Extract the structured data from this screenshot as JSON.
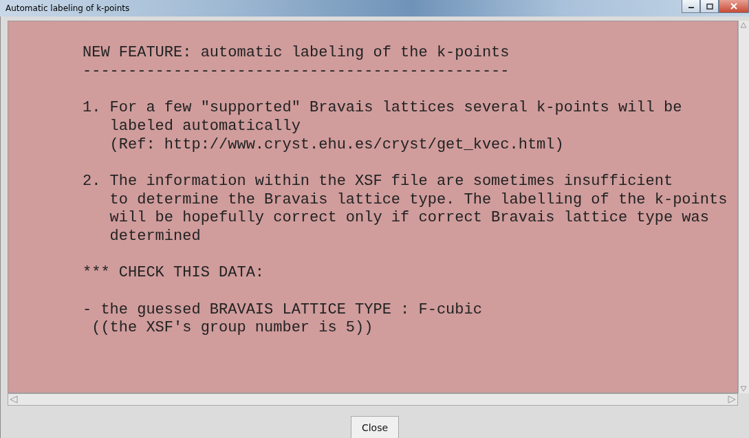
{
  "window": {
    "title": "Automatic labeling of k-points"
  },
  "message": {
    "blocks": [
      [
        "NEW FEATURE: automatic labeling of the k-points",
        "-----------------------------------------------"
      ],
      [
        "1. For a few \"supported\" Bravais lattices several k-points will be",
        "   labeled automatically",
        "   (Ref: http://www.cryst.ehu.es/cryst/get_kvec.html)"
      ],
      [
        "2. The information within the XSF file are sometimes insufficient",
        "   to determine the Bravais lattice type. The labelling of the k-points",
        "   will be hopefully correct only if correct Bravais lattice type was",
        "   determined"
      ],
      [
        "*** CHECK THIS DATA:"
      ],
      [
        "- the guessed BRAVAIS LATTICE TYPE : F-cubic",
        " ((the XSF's group number is 5))"
      ]
    ]
  },
  "buttons": [
    {
      "label": "Close"
    }
  ]
}
